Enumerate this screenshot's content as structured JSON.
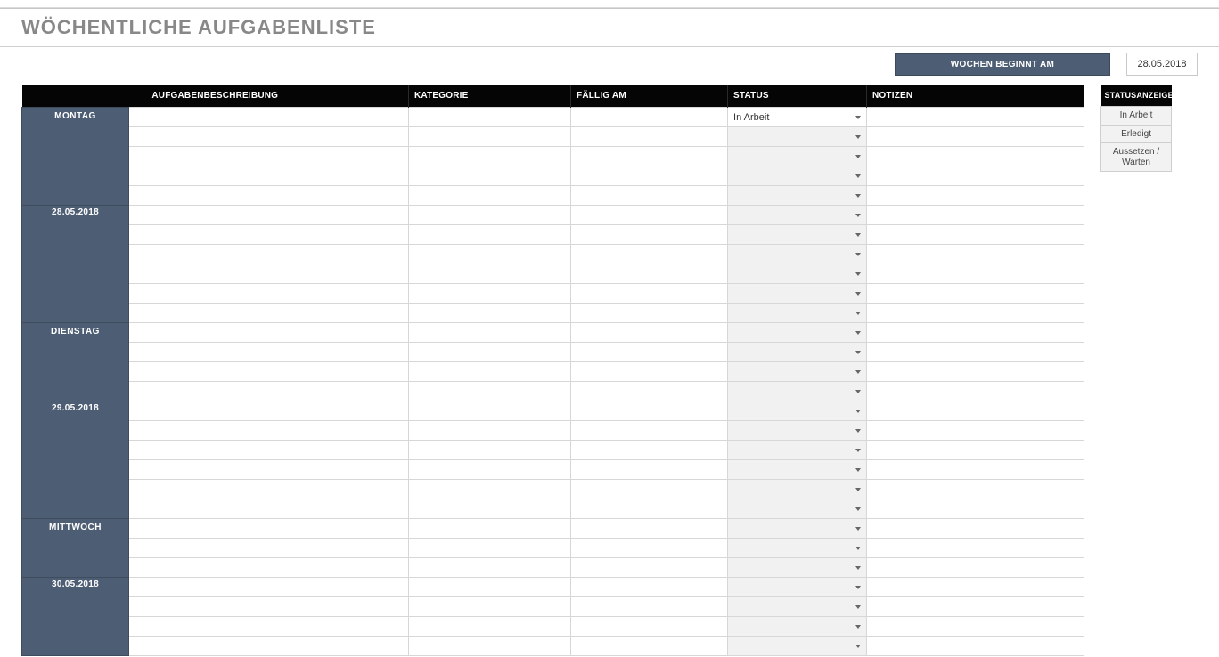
{
  "title": "WÖCHENTLICHE AUFGABENLISTE",
  "header": {
    "week_begins_label": "WOCHEN BEGINNT AM",
    "week_begins_date": "28.05.2018"
  },
  "columns": {
    "description": "AUFGABENBESCHREIBUNG",
    "category": "KATEGORIE",
    "due": "FÄLLIG AM",
    "status": "STATUS",
    "notes": "NOTIZEN"
  },
  "days": [
    {
      "name": "MONTAG",
      "date": "28.05.2018",
      "rows": 11,
      "tasks": [
        {
          "description": "",
          "category": "",
          "due": "",
          "status": "In Arbeit",
          "notes": ""
        },
        {},
        {},
        {},
        {},
        {},
        {},
        {},
        {},
        {},
        {}
      ]
    },
    {
      "name": "DIENSTAG",
      "date": "29.05.2018",
      "rows": 10,
      "tasks": [
        {},
        {},
        {},
        {},
        {},
        {},
        {},
        {},
        {},
        {}
      ]
    },
    {
      "name": "MITTWOCH",
      "date": "30.05.2018",
      "rows": 7,
      "tasks": [
        {},
        {},
        {},
        {},
        {},
        {},
        {}
      ]
    }
  ],
  "legend": {
    "header": "STATUSANZEIGE",
    "items": [
      "In Arbeit",
      "Erledigt",
      "Aussetzen / Warten"
    ]
  }
}
